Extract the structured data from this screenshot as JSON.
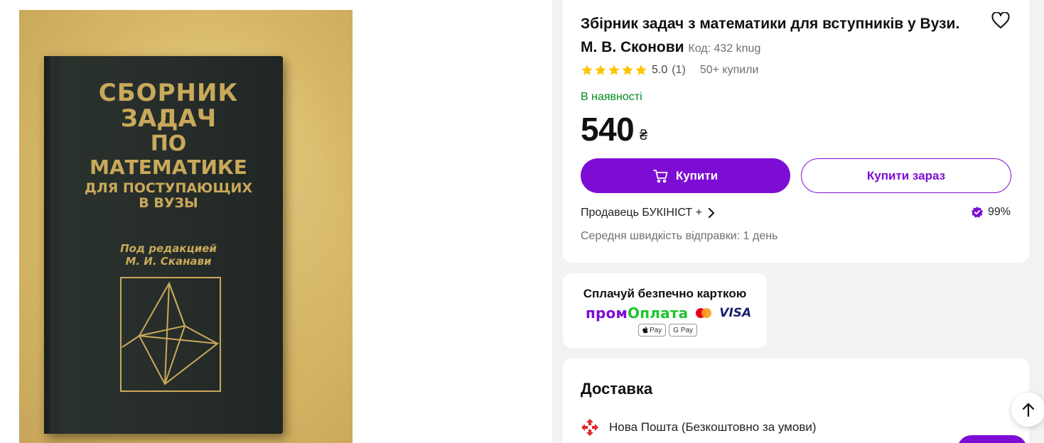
{
  "product": {
    "title": "Збірник задач з математики для вступників у Вузи. М. В. Сконови",
    "code_label": "Код: 432 knug",
    "rating_value": "5.0",
    "rating_count": "(1)",
    "bought": "50+ купили",
    "rating_stars": 5,
    "stock": "В наявності",
    "price": "540",
    "currency": "₴",
    "buy_label": "Купити",
    "buy_now_label": "Купити зараз",
    "seller_label": "Продавець БУКІНІСТ +",
    "seller_score": "99%",
    "ship_speed": "Середня швидкість відправки: 1 день"
  },
  "book_cover": {
    "line1": "СБОРНИК",
    "line2": "ЗАДАЧ",
    "line3": "ПО",
    "line4": "МАТЕМАТИКЕ",
    "line5": "ДЛЯ ПОСТУПАЮЩИХ",
    "line6": "В ВУЗЫ",
    "editor1": "Под редакцией",
    "editor2": "М. И. Сканави"
  },
  "payment": {
    "title": "Сплачуй безпечно карткою",
    "prom_part1": "пром",
    "prom_part2": "Оплата",
    "visa": "VISA",
    "apple_pay": "Pay",
    "google_pay": "G Pay"
  },
  "delivery": {
    "title": "Доставка",
    "nova_poshta": "Нова Пошта (Безкоштовно за умови)"
  },
  "icons": {
    "heart": "heart-icon",
    "star": "star-icon",
    "cart": "cart-icon",
    "chevron": "chevron-right-icon",
    "badge": "seller-badge-icon",
    "nova_poshta": "nova-poshta-icon",
    "arrow_up": "arrow-up-icon"
  },
  "colors": {
    "accent": "#7d0dd4",
    "stock": "#008a1c",
    "star": "#ffc400"
  }
}
